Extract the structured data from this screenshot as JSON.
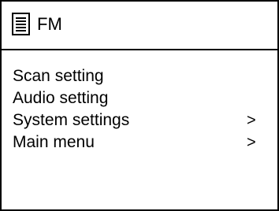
{
  "header": {
    "icon": "menu-list-icon",
    "title": "FM"
  },
  "menu": {
    "items": [
      {
        "label": "Scan setting",
        "arrow": ""
      },
      {
        "label": "Audio setting",
        "arrow": ""
      },
      {
        "label": "System settings",
        "arrow": ">"
      },
      {
        "label": "Main menu",
        "arrow": ">"
      }
    ]
  }
}
